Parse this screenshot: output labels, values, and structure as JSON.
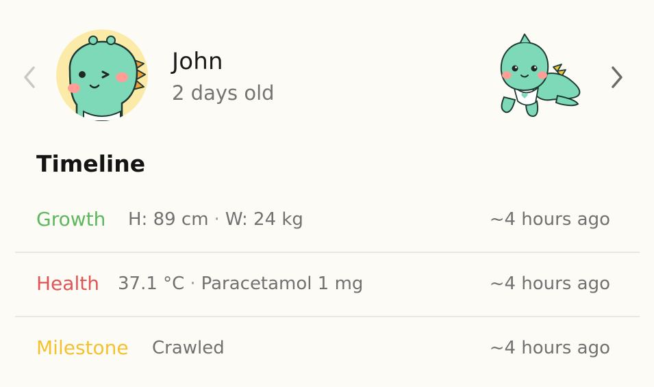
{
  "header": {
    "prev_icon": "chevron-left-icon",
    "next_icon": "chevron-right-icon",
    "avatar_icon": "dino-avatar-icon",
    "mascot_icon": "crawling-dino-icon",
    "name": "John",
    "age": "2 days old"
  },
  "timeline": {
    "title": "Timeline",
    "entries": [
      {
        "type": "Growth",
        "color": "#5cb85c",
        "details": [
          "H: 89 cm",
          "W: 24 kg"
        ],
        "time": "~4 hours ago"
      },
      {
        "type": "Health",
        "color": "#e05555",
        "details": [
          "37.1 °C",
          "Paracetamol 1 mg"
        ],
        "time": "~4 hours ago"
      },
      {
        "type": "Milestone",
        "color": "#f2c230",
        "details": [
          "Crawled"
        ],
        "time": "~4 hours ago"
      }
    ]
  },
  "colors": {
    "background": "#fcfbf6",
    "dino_green": "#7dd9b7",
    "avatar_bg": "#fbeaa8",
    "chevron_left": "#c8c8c8",
    "chevron_right": "#6a6a6a"
  }
}
